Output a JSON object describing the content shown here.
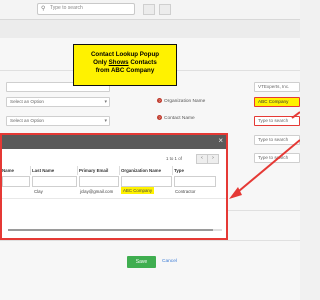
{
  "topbar": {
    "search_placeholder": "Type to search"
  },
  "callout": {
    "line1": "Contact Lookup Popup",
    "line2_prefix": "Only ",
    "line2_underline": "Shows",
    "line2_suffix": "  Contacts",
    "line3": "from ABC Company",
    "background": "#fff200"
  },
  "form": {
    "left_select1": "Select an Option",
    "left_select2": "Select an Option",
    "right_value_top": "VTExperts, Inc.",
    "org_label": "Organization Name",
    "org_value": "ABC Company",
    "contact_label": "Contact Name",
    "contact_placeholder": "Type to search",
    "right_placeholder3": "Type to search",
    "right_placeholder4": "Type to search"
  },
  "modal": {
    "pager_text": "1 to 1  of",
    "columns": [
      "Name",
      "Last Name",
      "Primary Email",
      "Organization Name",
      "Type"
    ],
    "rows": [
      {
        "name": "",
        "last_name": "Clay",
        "email": "jclay@gmail.com",
        "organization": "ABC Company",
        "type": "Contractor"
      }
    ],
    "border_color": "#e53935"
  },
  "footer": {
    "save_label": "Save",
    "cancel_label": "Cancel"
  },
  "colors": {
    "highlight": "#fff200",
    "alert": "#e53935",
    "save": "#3fae50"
  }
}
